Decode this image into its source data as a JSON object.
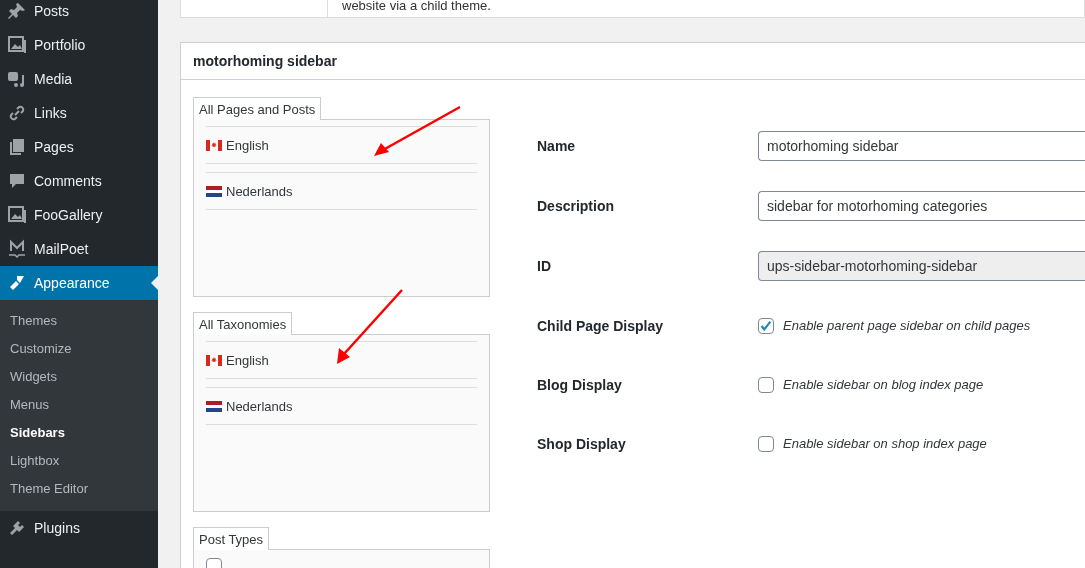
{
  "sidebar": {
    "items": [
      {
        "label": "Posts",
        "selected": false
      },
      {
        "label": "Portfolio",
        "selected": false
      },
      {
        "label": "Media",
        "selected": false
      },
      {
        "label": "Links",
        "selected": false
      },
      {
        "label": "Pages",
        "selected": false
      },
      {
        "label": "Comments",
        "selected": false
      },
      {
        "label": "FooGallery",
        "selected": false
      },
      {
        "label": "MailPoet",
        "selected": false
      },
      {
        "label": "Appearance",
        "selected": true,
        "submenu": [
          {
            "label": "Themes",
            "selected": false
          },
          {
            "label": "Customize",
            "selected": false
          },
          {
            "label": "Widgets",
            "selected": false
          },
          {
            "label": "Menus",
            "selected": false
          },
          {
            "label": "Sidebars",
            "selected": true
          },
          {
            "label": "Lightbox",
            "selected": false
          },
          {
            "label": "Theme Editor",
            "selected": false
          }
        ]
      },
      {
        "label": "Plugins",
        "selected": false
      }
    ]
  },
  "top_card": {
    "text": "website via a child theme."
  },
  "panel": {
    "title": "motorhoming sidebar",
    "groups": [
      {
        "tab": "All Pages and Posts",
        "items": [
          {
            "kind": "language",
            "label": "English"
          },
          {
            "kind": "language",
            "label": "Nederlands"
          }
        ]
      },
      {
        "tab": "All Taxonomies",
        "items": [
          {
            "kind": "language",
            "label": "English"
          },
          {
            "kind": "language",
            "label": "Nederlands"
          }
        ]
      },
      {
        "tab": "Post Types",
        "items": [
          {
            "kind": "checkbox",
            "checked": false
          }
        ]
      }
    ],
    "fields": [
      {
        "kind": "text",
        "label": "Name",
        "value": "motorhoming sidebar",
        "disabled": false
      },
      {
        "kind": "text",
        "label": "Description",
        "value": "sidebar for motorhoming categories",
        "disabled": false
      },
      {
        "kind": "text",
        "label": "ID",
        "value": "ups-sidebar-motorhoming-sidebar",
        "disabled": true
      },
      {
        "kind": "checkbox",
        "label": "Child Page Display",
        "text": "Enable parent page sidebar on child pages",
        "checked": true
      },
      {
        "kind": "checkbox",
        "label": "Blog Display",
        "text": "Enable sidebar on blog index page",
        "checked": false
      },
      {
        "kind": "checkbox",
        "label": "Shop Display",
        "text": "Enable sidebar on shop index page",
        "checked": false
      }
    ]
  }
}
